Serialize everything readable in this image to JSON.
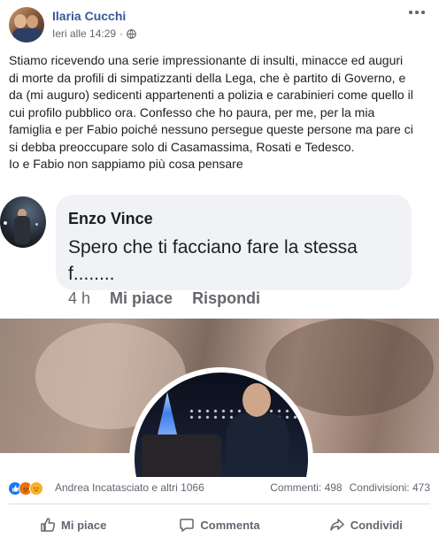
{
  "post": {
    "author": "Ilaria Cucchi",
    "timestamp": "Ieri alle 14:29",
    "privacy_icon": "globe-icon",
    "text_lines": [
      "Stiamo ricevendo una serie impressionante di insulti, minacce ed auguri",
      "di morte da profili di simpatizzanti della Lega, che è partito di Governo, e",
      "da (mi auguro) sedicenti appartenenti a polizia e carabinieri come quello il",
      "cui profilo pubblico ora. Confesso che ho paura, per me, per la mia",
      "famiglia e per Fabio poiché nessuno persegue queste persone ma pare ci",
      "si debba preoccupare solo di Casamassima, Rosati e Tedesco.",
      "Io e Fabio non sappiamo più cosa pensare"
    ]
  },
  "shared_comment": {
    "commenter": "Enzo Vince",
    "text_line1": "Spero che ti facciano fare la stessa",
    "text_line2": "f........",
    "time": "4 h",
    "like_label": "Mi piace",
    "reply_label": "Rispondi"
  },
  "stats": {
    "reactions": [
      "like-icon",
      "angry-icon",
      "sad-icon"
    ],
    "likers": "Andrea Incatasciato e altri 1066",
    "comments": "Commenti: 498",
    "shares": "Condivisioni: 473"
  },
  "actions": {
    "like": "Mi piace",
    "comment": "Commenta",
    "share": "Condividi"
  },
  "colors": {
    "author_link": "#385898",
    "secondary_text": "#606770",
    "bubble_bg": "#f0f2f5",
    "like_blue": "#1877f2"
  }
}
